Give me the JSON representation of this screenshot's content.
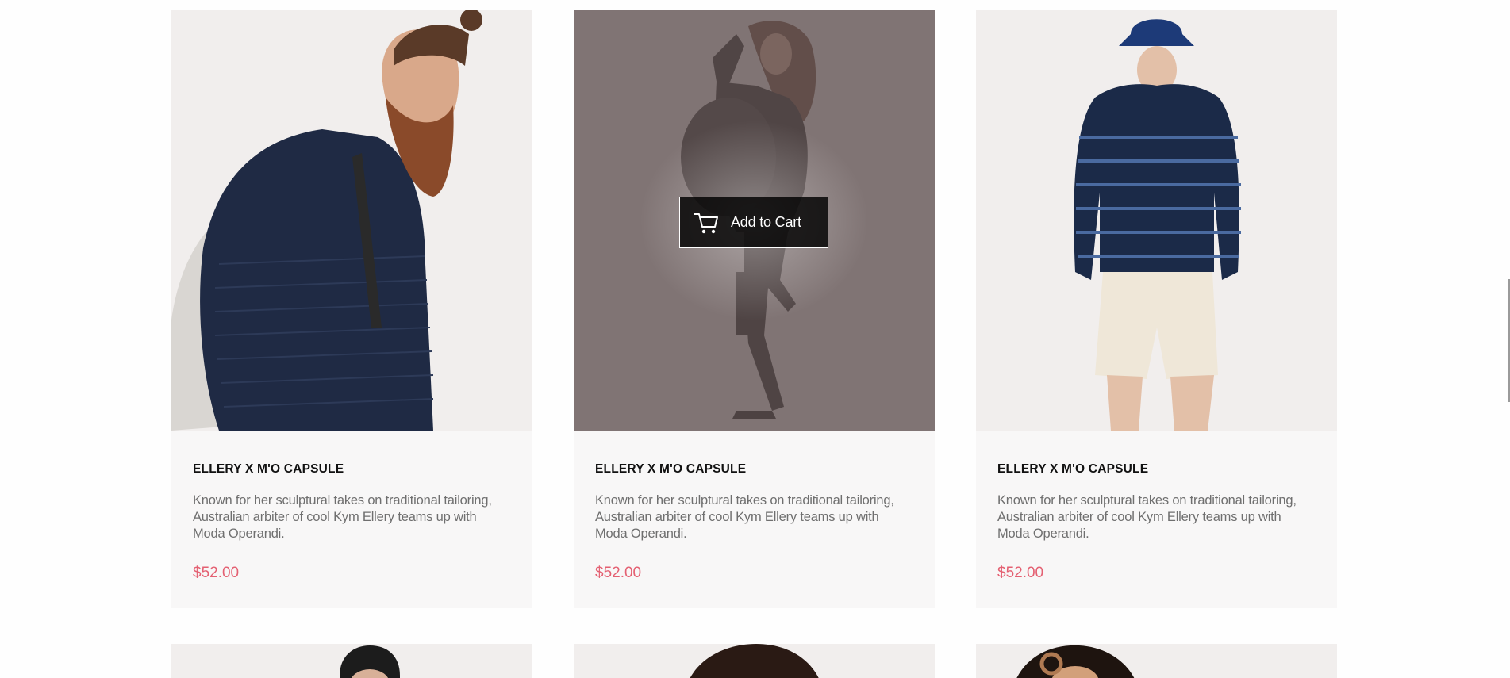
{
  "products_row1": [
    {
      "title": "ELLERY X M'O CAPSULE",
      "description": "Known for her sculptural takes on traditional tailoring, Australian arbiter of cool Kym Ellery teams up with Moda Operandi.",
      "price": "$52.00"
    },
    {
      "title": "ELLERY X M'O CAPSULE",
      "description": "Known for her sculptural takes on traditional tailoring, Australian arbiter of cool Kym Ellery teams up with Moda Operandi.",
      "price": "$52.00",
      "hover_action": "Add to Cart"
    },
    {
      "title": "ELLERY X M'O CAPSULE",
      "description": "Known for her sculptural takes on traditional tailoring, Australian arbiter of cool Kym Ellery teams up with Moda Operandi.",
      "price": "$52.00"
    }
  ],
  "icons": {
    "cart": "cart-icon"
  },
  "colors": {
    "price": "#e46072",
    "card_background": "#f8f7f7",
    "title": "#111111",
    "description": "#6f6f6f"
  }
}
